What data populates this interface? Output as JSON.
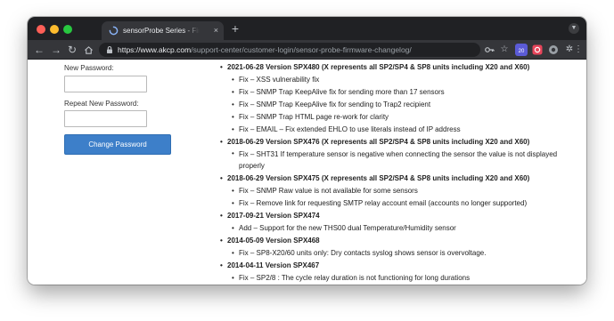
{
  "browser": {
    "tab_title": "sensorProbe Series - Firmware Changelog",
    "tab_close": "×",
    "new_tab": "+",
    "url_host": "https://www.akcp.com",
    "url_path": "/support-center/customer-login/sensor-probe-firmware-changelog/",
    "extension_badge": "20"
  },
  "form": {
    "new_password_label": "New Password:",
    "repeat_password_label": "Repeat New Password:",
    "new_password_value": "",
    "repeat_password_value": "",
    "change_button": "Change Password"
  },
  "changelog": [
    {
      "version": "2021-06-28 Version SPX480 (X represents all SP2/SP4 & SP8 units including X20 and X60)",
      "items": [
        "Fix – XSS vulnerability fix",
        "Fix – SNMP Trap KeepAlive fix for sending more than 17 sensors",
        "Fix – SNMP Trap KeepAlive fix for sending to Trap2 recipient",
        "Fix – SNMP Trap HTML page re-work for clarity",
        "Fix – EMAIL – Fix extended EHLO to use literals instead of IP address"
      ]
    },
    {
      "version": "2018-06-29 Version SPX476 (X represents all SP2/SP4 & SP8 units including X20 and X60)",
      "items": [
        "Fix – SHT31 If temperature sensor is negative when connecting the sensor the value is not displayed properly"
      ]
    },
    {
      "version": "2018-06-29 Version SPX475 (X represents all SP2/SP4 & SP8 units including X20 and X60)",
      "items": [
        "Fix – SNMP Raw value is not available for some sensors",
        "Fix – Remove link for requesting SMTP relay account email (accounts no longer supported)"
      ]
    },
    {
      "version": "2017-09-21 Version SPX474",
      "items": [
        "Add – Support for the new THS00 dual Temperature/Humidity sensor"
      ]
    },
    {
      "version": "2014-05-09 Version SPX468",
      "items": [
        "Fix – SP8-X20/60 units only: Dry contacts syslog shows sensor is overvoltage."
      ]
    },
    {
      "version": "2014-04-11 Version SPX467",
      "items": [
        "Fix – SP2/8 : The cycle relay duration is not functioning for long durations"
      ]
    }
  ]
}
